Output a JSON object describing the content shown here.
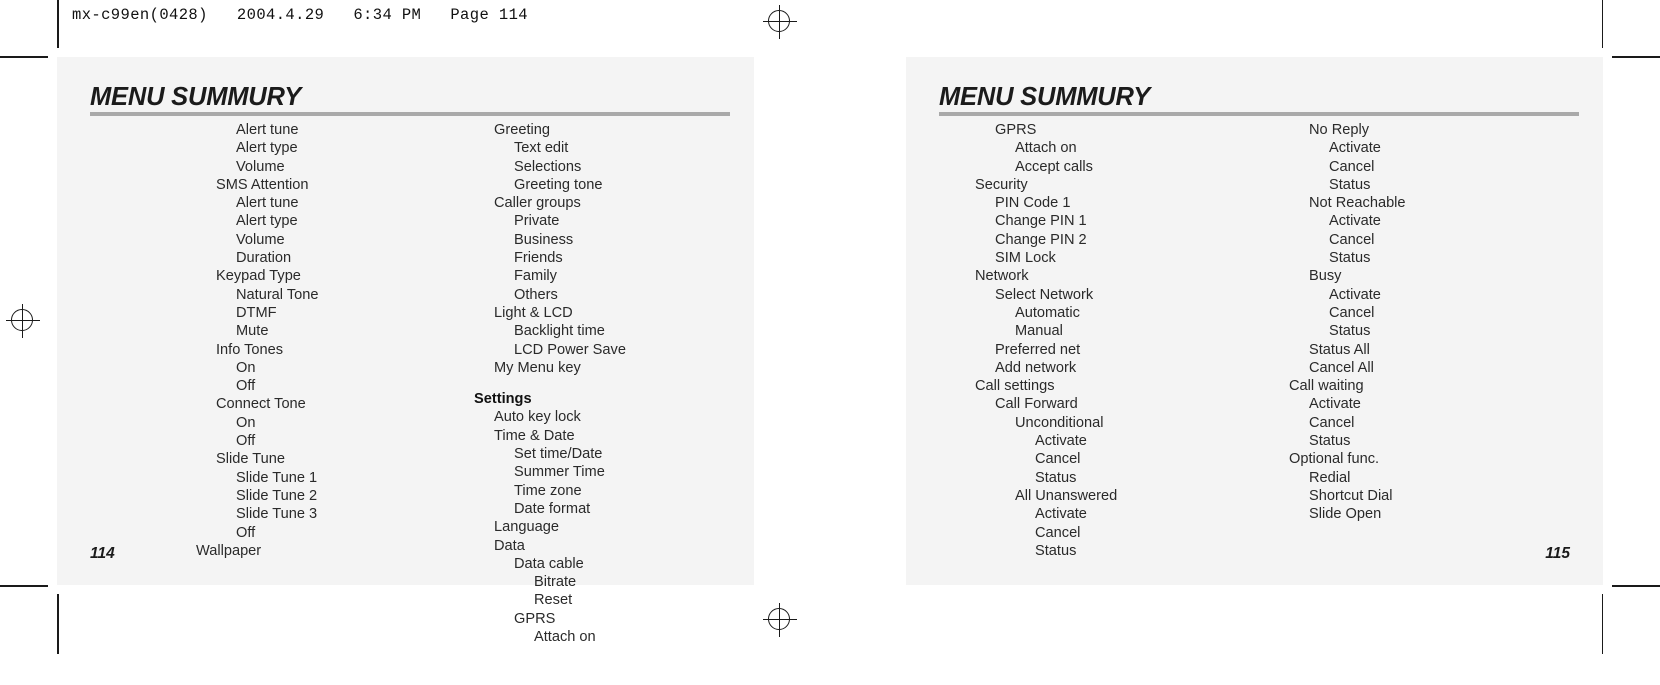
{
  "header": {
    "slug": "mx-c99en(0428)   2004.4.29   6:34 PM   Page 114"
  },
  "left_page": {
    "title": "MENU SUMMURY",
    "folio": "114",
    "columns": [
      {
        "name": "column-1",
        "items": [
          {
            "label": "Alert tune",
            "level": 2
          },
          {
            "label": "Alert type",
            "level": 2
          },
          {
            "label": "Volume",
            "level": 2
          },
          {
            "label": "SMS Attention",
            "level": 1
          },
          {
            "label": "Alert tune",
            "level": 2
          },
          {
            "label": "Alert type",
            "level": 2
          },
          {
            "label": "Volume",
            "level": 2
          },
          {
            "label": "Duration",
            "level": 2
          },
          {
            "label": "Keypad Type",
            "level": 1
          },
          {
            "label": "Natural Tone",
            "level": 2
          },
          {
            "label": "DTMF",
            "level": 2
          },
          {
            "label": "Mute",
            "level": 2
          },
          {
            "label": "Info Tones",
            "level": 1
          },
          {
            "label": "On",
            "level": 2
          },
          {
            "label": "Off",
            "level": 2
          },
          {
            "label": "Connect Tone",
            "level": 1
          },
          {
            "label": "On",
            "level": 2
          },
          {
            "label": "Off",
            "level": 2
          },
          {
            "label": "Slide Tune",
            "level": 1
          },
          {
            "label": "Slide Tune 1",
            "level": 2
          },
          {
            "label": "Slide Tune 2",
            "level": 2
          },
          {
            "label": "Slide Tune 3",
            "level": 2
          },
          {
            "label": "Off",
            "level": 2
          },
          {
            "label": "Wallpaper",
            "level": 0
          }
        ]
      },
      {
        "name": "column-2",
        "items": [
          {
            "label": "Greeting",
            "level": 1
          },
          {
            "label": "Text edit",
            "level": 2
          },
          {
            "label": "Selections",
            "level": 2
          },
          {
            "label": "Greeting tone",
            "level": 2
          },
          {
            "label": "Caller groups",
            "level": 1
          },
          {
            "label": "Private",
            "level": 2
          },
          {
            "label": "Business",
            "level": 2
          },
          {
            "label": "Friends",
            "level": 2
          },
          {
            "label": "Family",
            "level": 2
          },
          {
            "label": "Others",
            "level": 2
          },
          {
            "label": "Light & LCD",
            "level": 1
          },
          {
            "label": "Backlight time",
            "level": 2
          },
          {
            "label": "LCD Power Save",
            "level": 2
          },
          {
            "label": "My Menu key",
            "level": 1
          },
          {
            "label": "Settings",
            "level": 0,
            "bold": true,
            "gap": true
          },
          {
            "label": "Auto key lock",
            "level": 1
          },
          {
            "label": "Time & Date",
            "level": 1
          },
          {
            "label": "Set time/Date",
            "level": 2
          },
          {
            "label": "Summer Time",
            "level": 2
          },
          {
            "label": "Time zone",
            "level": 2
          },
          {
            "label": "Date format",
            "level": 2
          },
          {
            "label": "Language",
            "level": 1
          },
          {
            "label": "Data",
            "level": 1
          },
          {
            "label": "Data cable",
            "level": 2
          },
          {
            "label": "Bitrate",
            "level": 3
          },
          {
            "label": "Reset",
            "level": 3
          },
          {
            "label": "GPRS",
            "level": 2
          },
          {
            "label": "Attach on",
            "level": 3
          }
        ]
      }
    ]
  },
  "right_page": {
    "title": "MENU SUMMURY",
    "folio": "115",
    "columns": [
      {
        "name": "column-3",
        "items": [
          {
            "label": "GPRS",
            "level": 1
          },
          {
            "label": "Attach on",
            "level": 2
          },
          {
            "label": "Accept calls",
            "level": 2
          },
          {
            "label": "Security",
            "level": 0
          },
          {
            "label": "PIN Code 1",
            "level": 1
          },
          {
            "label": "Change PIN 1",
            "level": 1
          },
          {
            "label": "Change PIN 2",
            "level": 1
          },
          {
            "label": "SIM Lock",
            "level": 1
          },
          {
            "label": "Network",
            "level": 0
          },
          {
            "label": "Select Network",
            "level": 1
          },
          {
            "label": "Automatic",
            "level": 2
          },
          {
            "label": "Manual",
            "level": 2
          },
          {
            "label": "Preferred net",
            "level": 1
          },
          {
            "label": "Add network",
            "level": 1
          },
          {
            "label": "Call settings",
            "level": 0
          },
          {
            "label": "Call Forward",
            "level": 1
          },
          {
            "label": "Unconditional",
            "level": 2
          },
          {
            "label": "Activate",
            "level": 3
          },
          {
            "label": "Cancel",
            "level": 3
          },
          {
            "label": "Status",
            "level": 3
          },
          {
            "label": "All Unanswered",
            "level": 2
          },
          {
            "label": "Activate",
            "level": 3
          },
          {
            "label": "Cancel",
            "level": 3
          },
          {
            "label": "Status",
            "level": 3
          }
        ]
      },
      {
        "name": "column-4",
        "items": [
          {
            "label": "No Reply",
            "level": 1
          },
          {
            "label": "Activate",
            "level": 2
          },
          {
            "label": "Cancel",
            "level": 2
          },
          {
            "label": "Status",
            "level": 2
          },
          {
            "label": "Not Reachable",
            "level": 1
          },
          {
            "label": "Activate",
            "level": 2
          },
          {
            "label": "Cancel",
            "level": 2
          },
          {
            "label": "Status",
            "level": 2
          },
          {
            "label": "Busy",
            "level": 1
          },
          {
            "label": "Activate",
            "level": 2
          },
          {
            "label": "Cancel",
            "level": 2
          },
          {
            "label": "Status",
            "level": 2
          },
          {
            "label": "Status All",
            "level": 1
          },
          {
            "label": "Cancel All",
            "level": 1
          },
          {
            "label": "Call waiting",
            "level": 0
          },
          {
            "label": "Activate",
            "level": 1
          },
          {
            "label": "Cancel",
            "level": 1
          },
          {
            "label": "Status",
            "level": 1
          },
          {
            "label": "Optional func.",
            "level": 0
          },
          {
            "label": "Redial",
            "level": 1
          },
          {
            "label": "Shortcut Dial",
            "level": 1
          },
          {
            "label": "Slide Open",
            "level": 1
          }
        ]
      }
    ]
  }
}
